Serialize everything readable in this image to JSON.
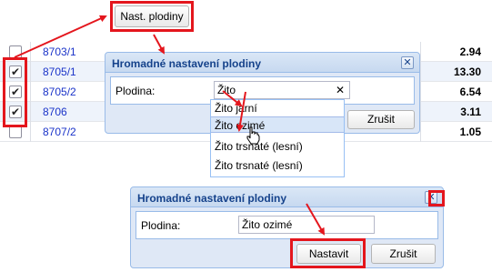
{
  "toolbar": {
    "nast_plodiny_label": "Nast. plodiny"
  },
  "grid": {
    "rows": [
      {
        "code": "8703/1",
        "value": "2.94",
        "checked": false
      },
      {
        "code": "8705/1",
        "value": "13.30",
        "checked": true
      },
      {
        "code": "8705/2",
        "value": "6.54",
        "checked": true
      },
      {
        "code": "8706",
        "value": "3.11",
        "checked": true
      },
      {
        "code": "8707/2",
        "value": "1.05",
        "checked": false
      }
    ]
  },
  "dialog_top": {
    "title": "Hromadné nastavení plodiny",
    "field_label": "Plodina:",
    "input_value": "Žito",
    "clear_glyph": "✕",
    "cancel_label": "Zrušit",
    "close_glyph": "✕",
    "options": [
      "Žito jarní",
      "Žito ozimé",
      "Žito trsnaté (lesní)",
      "Žito trsnaté (lesní)"
    ],
    "selected_option_index": 1
  },
  "dialog_bottom": {
    "title": "Hromadné nastavení plodiny",
    "field_label": "Plodina:",
    "input_value": "Žito ozimé",
    "confirm_label": "Nastavit",
    "cancel_label": "Zrušit",
    "close_glyph": "✕"
  },
  "colors": {
    "highlight": "#e4161d",
    "link": "#1b34c9",
    "dialog_title": "#15428b"
  }
}
